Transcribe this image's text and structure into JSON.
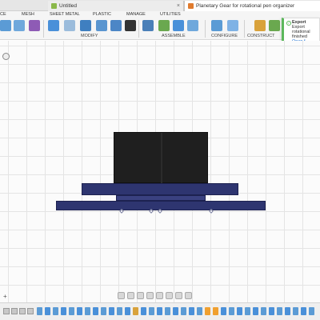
{
  "tabs": [
    {
      "label": "Untitled"
    },
    {
      "label": "Planetary Gear for rotational pen organizer"
    }
  ],
  "menu": [
    "CE",
    "MESH",
    "SHEET METAL",
    "PLASTIC",
    "MANAGE",
    "UTILITIES"
  ],
  "toolbar_groups": [
    "MODIFY",
    "ASSEMBLE",
    "CONFIGURE",
    "CONSTRUCT"
  ],
  "notification": {
    "title": "Export",
    "line1": "Export",
    "line2": "rotational",
    "line3": "finished",
    "link": "Open f"
  },
  "colors": {
    "accent": "#1a6fd1",
    "model": "#2e3570",
    "box": "#1f1f1f",
    "success": "#5cb85c"
  },
  "canvas": {
    "plus": "+"
  }
}
